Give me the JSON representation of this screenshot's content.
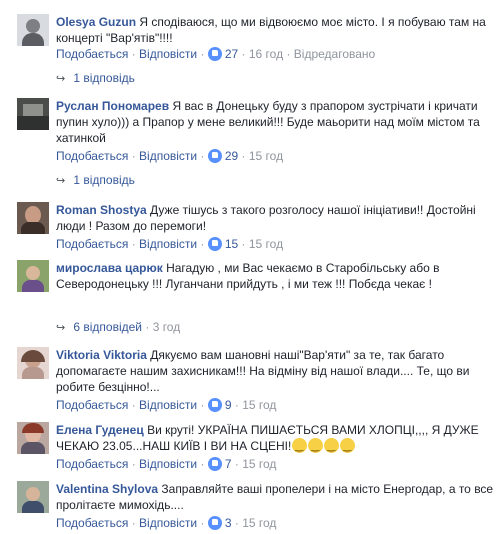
{
  "ui": {
    "like": "Подобається",
    "reply": "Відповісти",
    "dot": "·",
    "edited": "Відредаговано"
  },
  "comments": [
    {
      "author": "Olesya Guzun",
      "text": "Я сподіваюся, що ми відвоюємо моє місто. І я побуваю там на концерті \"Вар'ятів\"!!!!",
      "likes": "27",
      "time": "16 год",
      "edited": true,
      "replies": "1 відповідь"
    },
    {
      "author": "Руслан Пономарев",
      "text": "Я вас в Донецьку буду з прапором зустрічати і кричати пупин хуло))) а Прапор у мене великий!!! Буде маьорити над моїм містом та хатинкой",
      "likes": "29",
      "time": "15 год",
      "replies": "1 відповідь"
    },
    {
      "author": "Roman Shostya",
      "text": "Дуже тішусь з такого розголосу нашої ініціативи!! Достойні люди ! Разом до перемоги!",
      "likes": "15",
      "time": "15 год"
    },
    {
      "author": "мирослава царюк",
      "text": "Нагадую , ми Вас чекаємо в Старобільську або в Северодонецьку !!! Луганчани прийдуть , і ми теж !!! Побєда чекає !",
      "replies": "6 відповідей",
      "replies_time": "3 год"
    },
    {
      "author": "Viktoria Viktoria",
      "text": "Дякуємо вам шановні наші\"Вар'яти\" за те, так багато допомагаєте нашим захисникам!!! На відміну від нашої влади.... Те, що ви робите безцінно!...",
      "likes": "9",
      "time": "15 год"
    },
    {
      "author": "Елена Гуденец",
      "text": "Ви круті! УКРАЇНА ПИШАЄТЬСЯ ВАМИ ХЛОПЦІ,,,, Я ДУЖЕ ЧЕКАЮ 23.05...НАШ КИЇВ І ВИ НА СЦЕНІ!",
      "emoji": "smile-emoji",
      "likes": "7",
      "time": "15 год"
    },
    {
      "author": "Valentina Shylova",
      "text": "Заправляйте ваші пропелери і на місто Енергодар, а то все пролітаєте мимохідь....",
      "likes": "3",
      "time": "15 год"
    }
  ]
}
